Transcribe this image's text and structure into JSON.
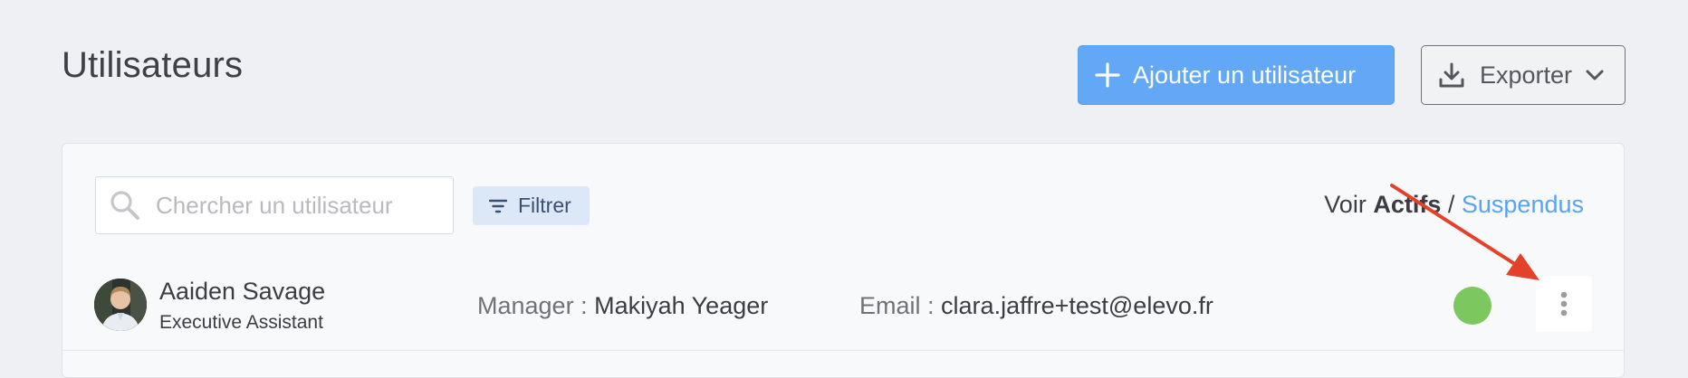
{
  "header": {
    "title": "Utilisateurs",
    "add_user_label": "Ajouter un utilisateur",
    "export_label": "Exporter"
  },
  "toolbar": {
    "search_placeholder": "Chercher un utilisateur",
    "filter_label": "Filtrer",
    "view_prefix": "Voir",
    "view_active": "Actifs",
    "view_separator": "/",
    "view_suspended": "Suspendus"
  },
  "users": [
    {
      "name": "Aaiden Savage",
      "role": "Executive Assistant",
      "manager_label": "Manager :",
      "manager": "Makiyah Yeager",
      "email_label": "Email :",
      "email": "clara.jaffre+test@elevo.fr",
      "status_color": "#7cc75e"
    }
  ],
  "colors": {
    "primary": "#62a8f6",
    "link": "#5aa2f2",
    "status_active": "#7cc75e",
    "annotation_arrow": "#e4412b"
  },
  "icons": {
    "add": "plus-icon",
    "export": "download-icon",
    "export_menu": "chevron-down-icon",
    "search": "search-icon",
    "filter": "filter-icon",
    "row_menu": "more-vertical-icon"
  }
}
